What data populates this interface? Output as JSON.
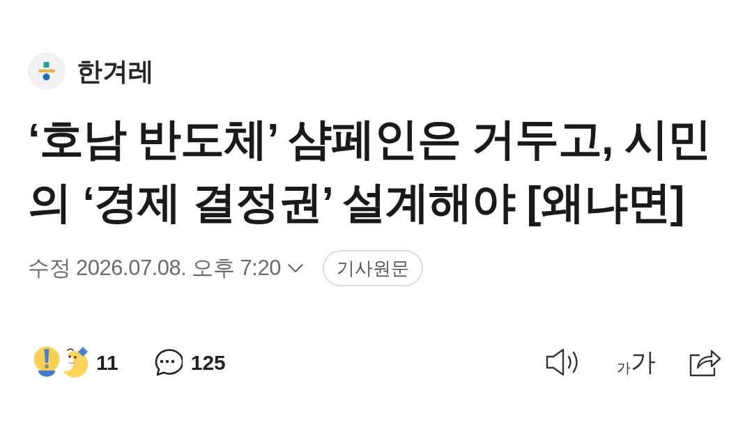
{
  "source": {
    "name": "한겨레"
  },
  "headline": "‘호남 반도체’ 샴페인은 거두고, 시민의 ‘경제 결정권’ 설계해야 [왜냐면]",
  "meta": {
    "timestamp": "수정 2026.07.08. 오후 7:20",
    "original_link": "기사원문"
  },
  "actions": {
    "reaction_count": "11",
    "comment_count": "125",
    "font_size": {
      "small": "가",
      "large": "가"
    }
  }
}
